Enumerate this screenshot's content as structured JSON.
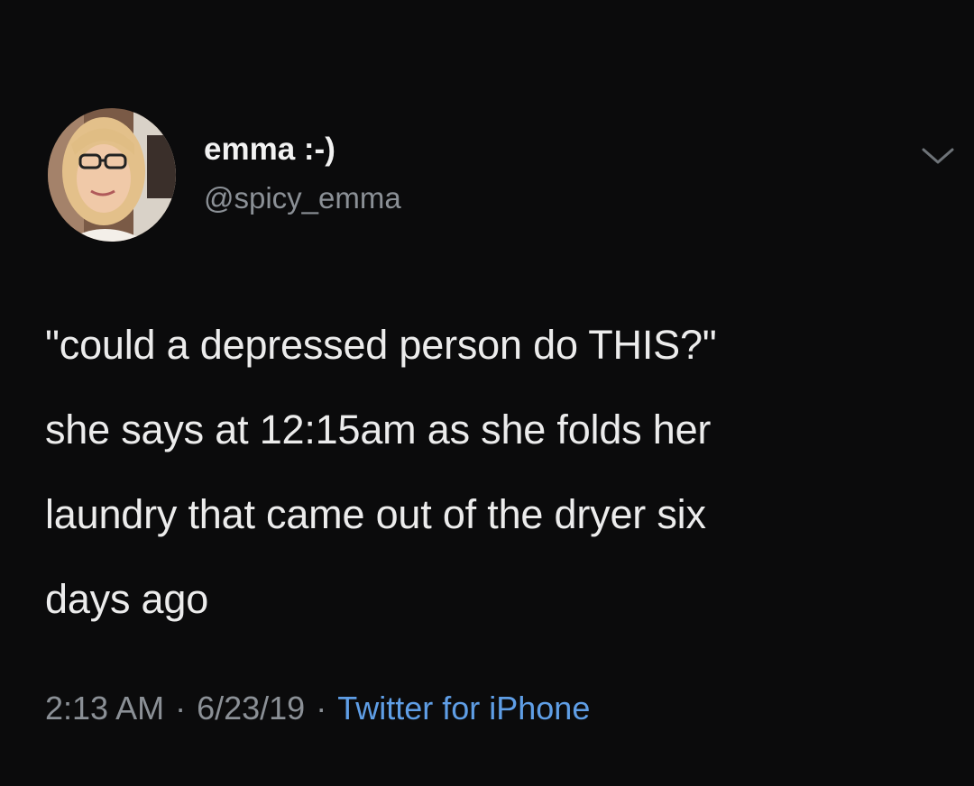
{
  "tweet": {
    "author": {
      "display_name": "emma :-)",
      "handle": "@spicy_emma",
      "avatar_icon": "avatar-photo"
    },
    "menu_icon": "chevron-down-icon",
    "text_lines": [
      "\"could a depressed person do THIS?\"",
      "she says at 12:15am as she folds her",
      "laundry that came out of the dryer six",
      "days ago"
    ],
    "meta": {
      "time": "2:13 AM",
      "separator": "·",
      "date": "6/23/19",
      "source": "Twitter for iPhone"
    }
  },
  "colors": {
    "background": "#0b0b0c",
    "text": "#ececec",
    "secondary": "#8b9096",
    "link": "#5f9ee6"
  }
}
